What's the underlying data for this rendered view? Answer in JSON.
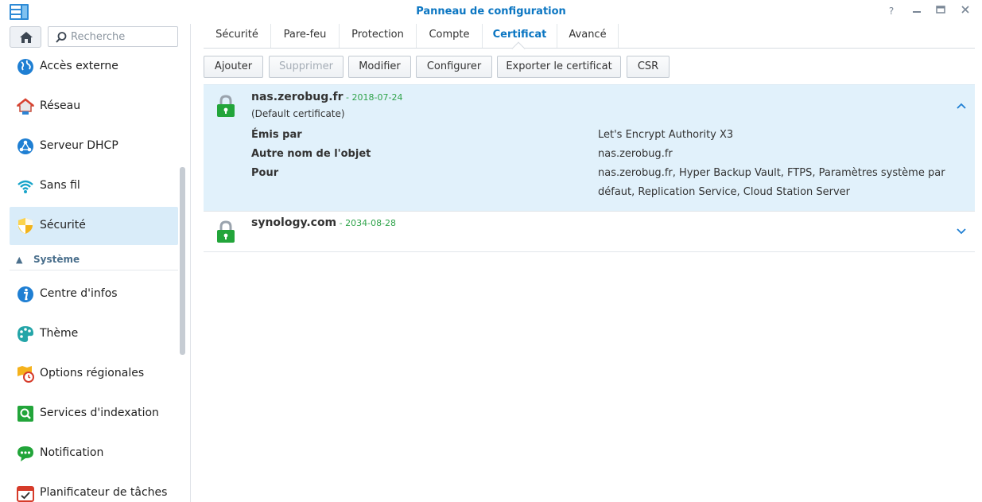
{
  "window": {
    "title": "Panneau de configuration"
  },
  "search": {
    "placeholder": "Recherche"
  },
  "sidebar": {
    "items": [
      {
        "label": "Accès externe"
      },
      {
        "label": "Réseau"
      },
      {
        "label": "Serveur DHCP"
      },
      {
        "label": "Sans fil"
      },
      {
        "label": "Sécurité"
      }
    ],
    "group": {
      "label": "Système"
    },
    "system_items": [
      {
        "label": "Centre d'infos"
      },
      {
        "label": "Thème"
      },
      {
        "label": "Options régionales"
      },
      {
        "label": "Services d'indexation"
      },
      {
        "label": "Notification"
      },
      {
        "label": "Planificateur de tâches"
      }
    ],
    "active": "Sécurité"
  },
  "tabs": [
    {
      "label": "Sécurité"
    },
    {
      "label": "Pare-feu"
    },
    {
      "label": "Protection"
    },
    {
      "label": "Compte"
    },
    {
      "label": "Certificat"
    },
    {
      "label": "Avancé"
    }
  ],
  "active_tab": "Certificat",
  "toolbar": {
    "add": "Ajouter",
    "delete": "Supprimer",
    "modify": "Modifier",
    "configure": "Configurer",
    "export": "Exporter le certificat",
    "csr": "CSR"
  },
  "certificates": [
    {
      "name": "nas.zerobug.fr",
      "date": " - 2018-07-24",
      "subtitle": "(Default certificate)",
      "expanded": true,
      "details": {
        "issuer_label": "Émis par",
        "issuer": "Let's Encrypt Authority X3",
        "san_label": "Autre nom de l'objet",
        "san": "nas.zerobug.fr",
        "for_label": "Pour",
        "for": "nas.zerobug.fr, Hyper Backup Vault, FTPS, Paramètres système par défaut, Replication Service, Cloud Station Server"
      }
    },
    {
      "name": "synology.com",
      "date": " - 2034-08-28",
      "expanded": false
    }
  ],
  "colors": {
    "accent": "#0b76c2",
    "date_green": "#2fa34a",
    "selected_bg": "#d9ecf9",
    "expanded_bg": "#e1f1fb",
    "lock_green": "#22a53a"
  },
  "icons": {
    "app": "control-panel-icon",
    "home": "home-icon",
    "search": "search-icon",
    "lock": "lock-icon",
    "chevron_up": "chevron-up-icon",
    "chevron_down": "chevron-down-icon"
  }
}
